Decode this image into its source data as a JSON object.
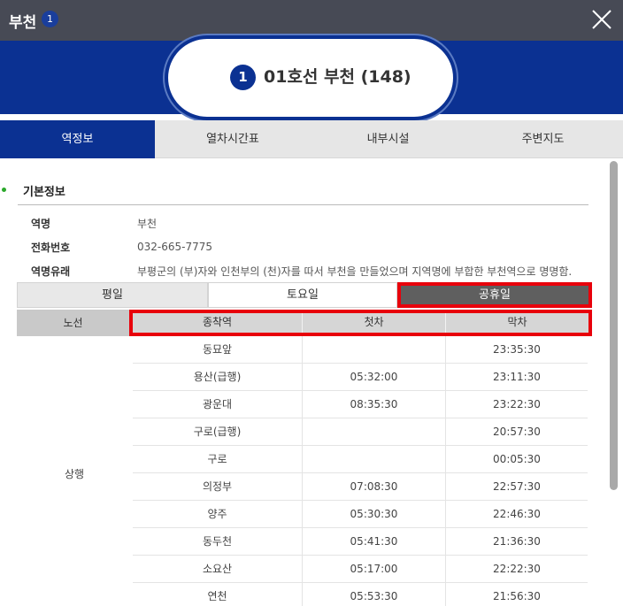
{
  "window": {
    "title": "부천",
    "line_number": "1",
    "close_icon": "close-icon"
  },
  "station": {
    "line_number": "1",
    "name": "01호선 부천 (148)"
  },
  "tabs": [
    {
      "label": "역정보",
      "active": true
    },
    {
      "label": "열차시간표",
      "active": false
    },
    {
      "label": "내부시설",
      "active": false
    },
    {
      "label": "주변지도",
      "active": false
    }
  ],
  "basic_info": {
    "title": "기본정보",
    "rows": [
      {
        "label": "역명",
        "value": "부천"
      },
      {
        "label": "전화번호",
        "value": "032-665-7775"
      },
      {
        "label": "역명유래",
        "value": "부평군의 (부)자와 인천부의 (천)자를 따서 부천을 만들었으며 지역명에 부합한 부천역으로 명명함."
      }
    ]
  },
  "day_tabs": [
    {
      "label": "평일",
      "active": false
    },
    {
      "label": "토요일",
      "active": false
    },
    {
      "label": "공휴일",
      "active": true
    }
  ],
  "timetable": {
    "headers": {
      "line": "노선",
      "terminal": "종착역",
      "first": "첫차",
      "last": "막차"
    },
    "direction": "상행",
    "rows": [
      {
        "terminal": "동묘앞",
        "first": "",
        "last": "23:35:30"
      },
      {
        "terminal": "용산(급행)",
        "first": "05:32:00",
        "last": "23:11:30"
      },
      {
        "terminal": "광운대",
        "first": "08:35:30",
        "last": "23:22:30"
      },
      {
        "terminal": "구로(급행)",
        "first": "",
        "last": "20:57:30"
      },
      {
        "terminal": "구로",
        "first": "",
        "last": "00:05:30"
      },
      {
        "terminal": "의정부",
        "first": "07:08:30",
        "last": "22:57:30"
      },
      {
        "terminal": "양주",
        "first": "05:30:30",
        "last": "22:46:30"
      },
      {
        "terminal": "동두천",
        "first": "05:41:30",
        "last": "21:36:30"
      },
      {
        "terminal": "소요산",
        "first": "05:17:00",
        "last": "22:22:30"
      },
      {
        "terminal": "연천",
        "first": "05:53:30",
        "last": "21:56:30"
      }
    ]
  },
  "colors": {
    "titlebar": "#474a55",
    "brand_blue": "#0b3192",
    "highlight_red": "#e8000b",
    "bullet_green": "#2ba82b"
  }
}
